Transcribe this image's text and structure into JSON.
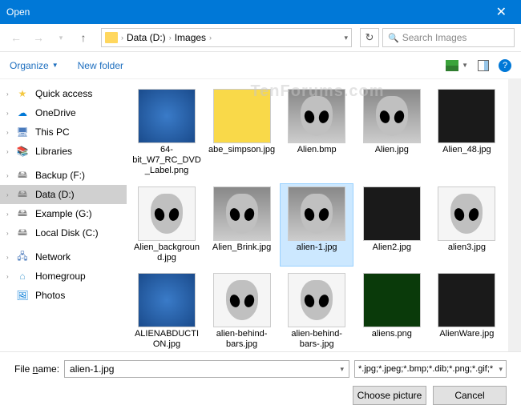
{
  "window": {
    "title": "Open"
  },
  "address": {
    "crumbs": [
      "Data (D:)",
      "Images"
    ]
  },
  "search": {
    "placeholder": "Search Images"
  },
  "toolbar": {
    "organize": "Organize",
    "newfolder": "New folder"
  },
  "sidebar": {
    "items": [
      {
        "label": "Quick access",
        "icon": "star",
        "chev": true
      },
      {
        "label": "OneDrive",
        "icon": "cloud",
        "chev": true
      },
      {
        "label": "This PC",
        "icon": "pc",
        "chev": true
      },
      {
        "label": "Libraries",
        "icon": "lib",
        "chev": true
      },
      {
        "label": "Backup (F:)",
        "icon": "drive",
        "chev": true
      },
      {
        "label": "Data (D:)",
        "icon": "drive",
        "chev": true,
        "selected": true
      },
      {
        "label": "Example (G:)",
        "icon": "drive",
        "chev": true
      },
      {
        "label": "Local Disk (C:)",
        "icon": "drive",
        "chev": true
      },
      {
        "label": "Network",
        "icon": "net",
        "chev": true
      },
      {
        "label": "Homegroup",
        "icon": "hg",
        "chev": true
      },
      {
        "label": "Photos",
        "icon": "photos",
        "chev": false
      }
    ]
  },
  "files": [
    {
      "name": "64-bit_W7_RC_DVD_Label.png",
      "thumbClass": "blue"
    },
    {
      "name": "abe_simpson.jpg",
      "thumbClass": "cartoon"
    },
    {
      "name": "Alien.bmp",
      "thumbClass": "alien-gray"
    },
    {
      "name": "Alien.jpg",
      "thumbClass": "alien-gray"
    },
    {
      "name": "Alien_48.jpg",
      "thumbClass": "dark"
    },
    {
      "name": "Alien_background.jpg",
      "thumbClass": "white"
    },
    {
      "name": "Alien_Brink.jpg",
      "thumbClass": "alien-gray"
    },
    {
      "name": "alien-1.jpg",
      "thumbClass": "alien-gray",
      "selected": true
    },
    {
      "name": "Alien2.jpg",
      "thumbClass": "dark"
    },
    {
      "name": "alien3.jpg",
      "thumbClass": "white"
    },
    {
      "name": "ALIENABDUCTION.jpg",
      "thumbClass": "blue"
    },
    {
      "name": "alien-behind-bars.jpg",
      "thumbClass": "white"
    },
    {
      "name": "alien-behind-bars-.jpg",
      "thumbClass": "white"
    },
    {
      "name": "aliens.png",
      "thumbClass": "green"
    },
    {
      "name": "AlienWare.jpg",
      "thumbClass": "dark"
    }
  ],
  "footer": {
    "filename_label_pre": "File ",
    "filename_label_u": "n",
    "filename_label_post": "ame:",
    "filename": "alien-1.jpg",
    "filter": "*.jpg;*.jpeg;*.bmp;*.dib;*.png;*.gif;*.jfif",
    "choose": "Choose picture",
    "cancel": "Cancel"
  },
  "watermark": "TenForums.com"
}
